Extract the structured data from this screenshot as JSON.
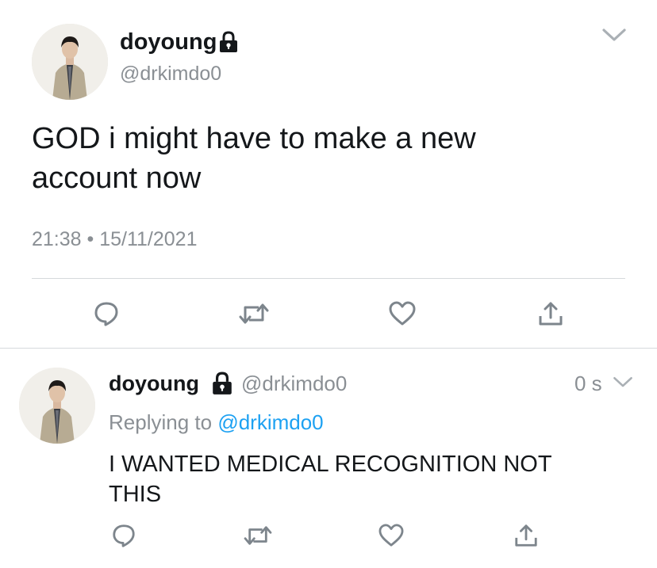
{
  "main_tweet": {
    "display_name": "doyoung",
    "handle": "@drkimdo0",
    "text_line1": "GOD i might have to make a new",
    "text_line2": "account now",
    "timestamp": "21:38 • 15/11/2021"
  },
  "reply_tweet": {
    "display_name": "doyoung",
    "handle": "@drkimdo0",
    "time_ago": "0 s",
    "replying_label": "Replying to",
    "replying_handle": "@drkimdo0",
    "text_line1": "I WANTED MEDICAL RECOGNITION NOT",
    "text_line2": "THIS"
  },
  "icons": {
    "protected": "lock-icon",
    "menu": "chevron-down-icon",
    "reply": "reply-icon",
    "retweet": "retweet-icon",
    "like": "heart-icon",
    "share": "share-icon"
  },
  "colors": {
    "text": "#14171a",
    "secondary": "#8a8f94",
    "link": "#1da1f2",
    "divider": "#d6d9dc"
  }
}
